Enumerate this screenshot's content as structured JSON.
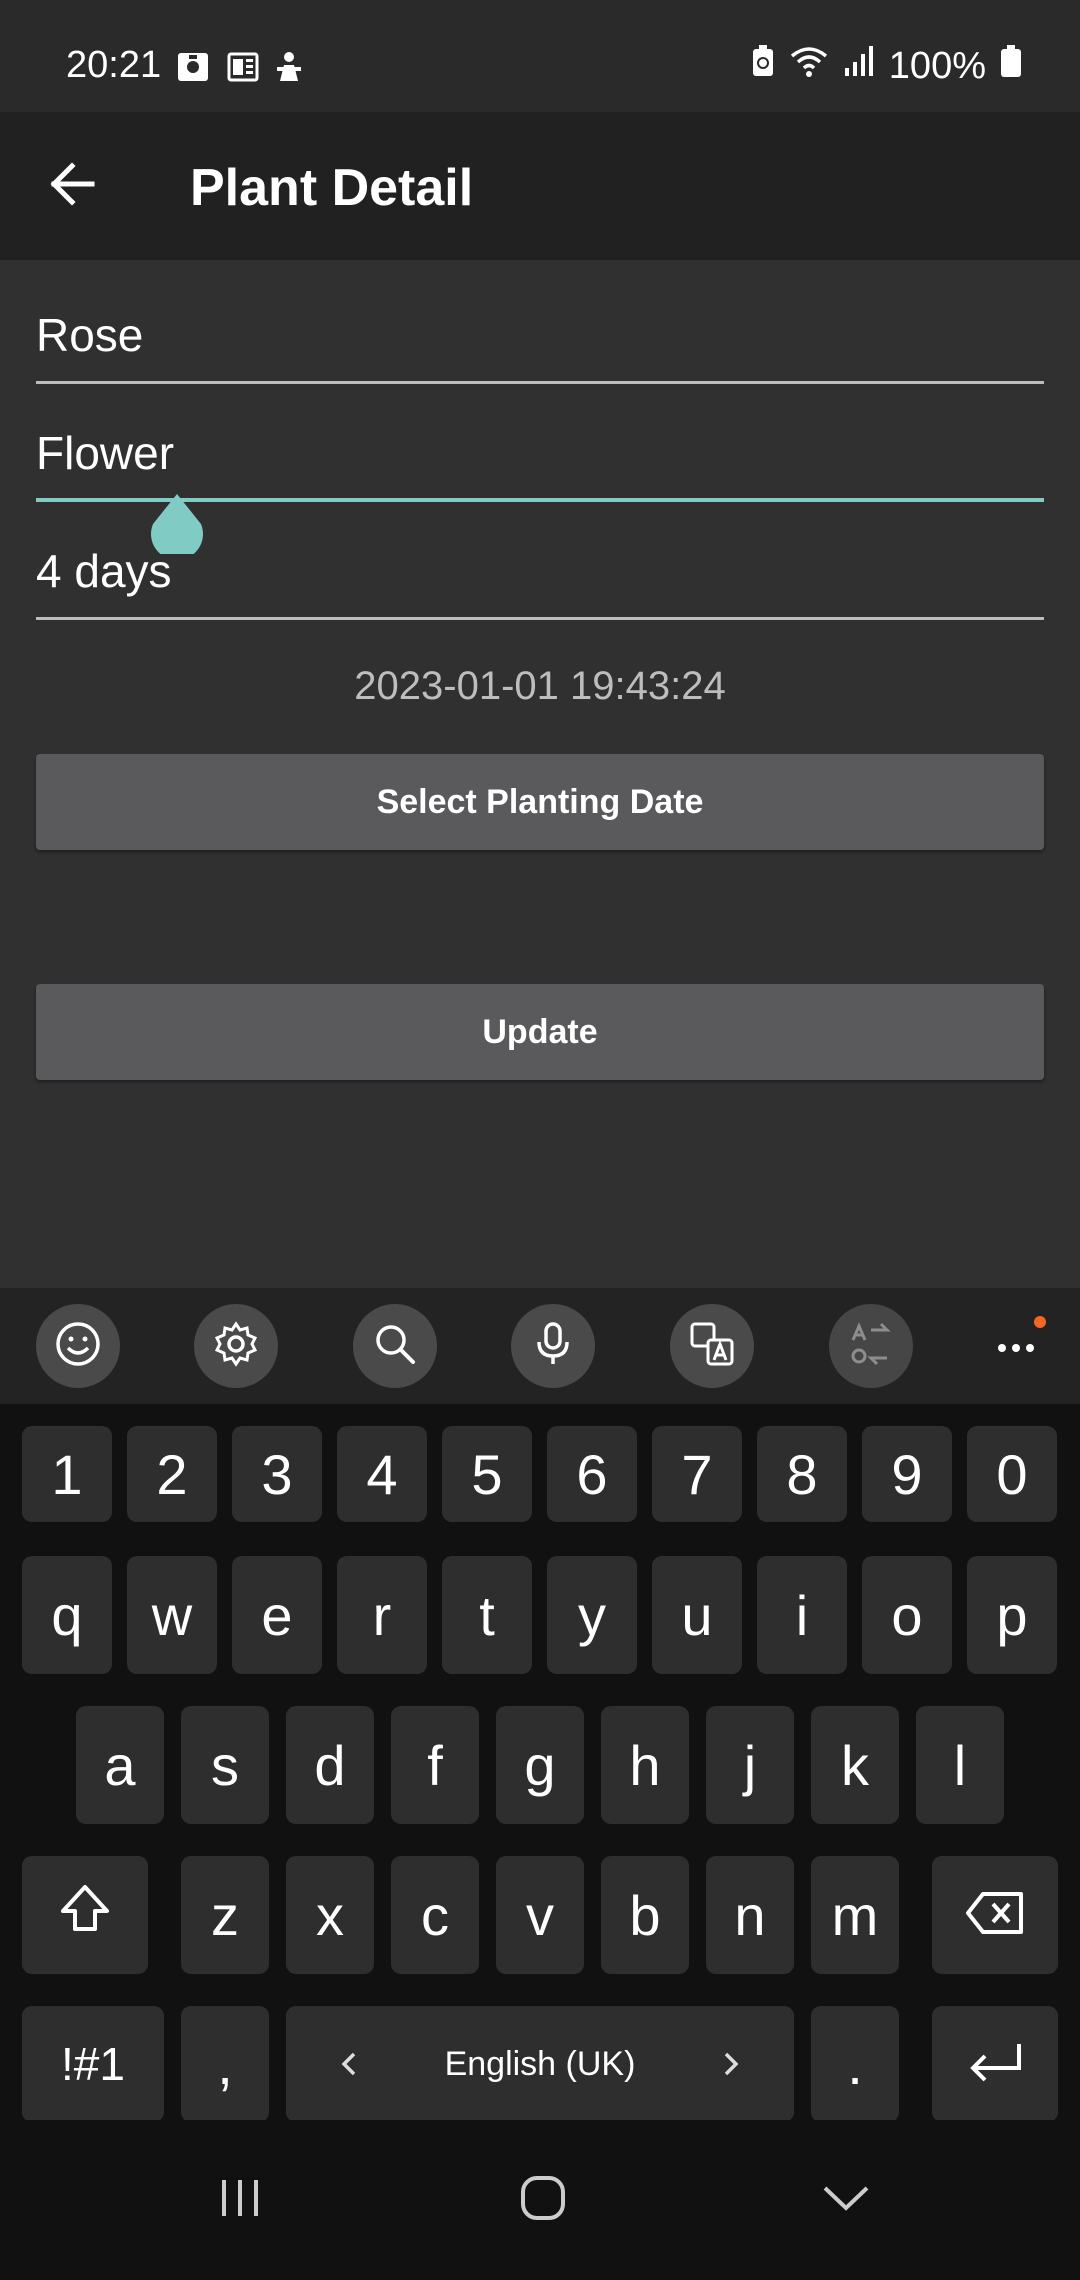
{
  "status_bar": {
    "time": "20:21",
    "battery_text": "100%",
    "left_icons": [
      "image-notification-icon",
      "news-notification-icon",
      "figure-notification-icon"
    ],
    "right_icons": [
      "battery-saver-icon",
      "wifi-icon",
      "signal-icon",
      "battery-icon"
    ]
  },
  "app_bar": {
    "title": "Plant Detail",
    "back_icon": "arrow-left-icon"
  },
  "form": {
    "name_value": "Rose",
    "type_value": "Flower",
    "interval_value": "4 days",
    "planting_date": "2023-01-01 19:43:24",
    "select_date_label": "Select Planting Date",
    "update_label": "Update"
  },
  "colors": {
    "accent": "#80cbc4",
    "background": "#303030",
    "app_bar": "#212121",
    "button": "#5a5a5c"
  },
  "keyboard": {
    "toolbar": [
      "emoji-icon",
      "settings-icon",
      "search-icon",
      "microphone-icon",
      "translate-icon",
      "text-transform-icon",
      "more-icon"
    ],
    "row_numbers": [
      "1",
      "2",
      "3",
      "4",
      "5",
      "6",
      "7",
      "8",
      "9",
      "0"
    ],
    "row_top": [
      "q",
      "w",
      "e",
      "r",
      "t",
      "y",
      "u",
      "i",
      "o",
      "p"
    ],
    "row_middle": [
      "a",
      "s",
      "d",
      "f",
      "g",
      "h",
      "j",
      "k",
      "l"
    ],
    "row_bottom": [
      "z",
      "x",
      "c",
      "v",
      "b",
      "n",
      "m"
    ],
    "symbols_label": "!#1",
    "comma_label": ",",
    "space_label": "English (UK)",
    "period_label": "."
  },
  "nav_bar": [
    "recent-apps-icon",
    "home-icon",
    "hide-keyboard-icon"
  ]
}
